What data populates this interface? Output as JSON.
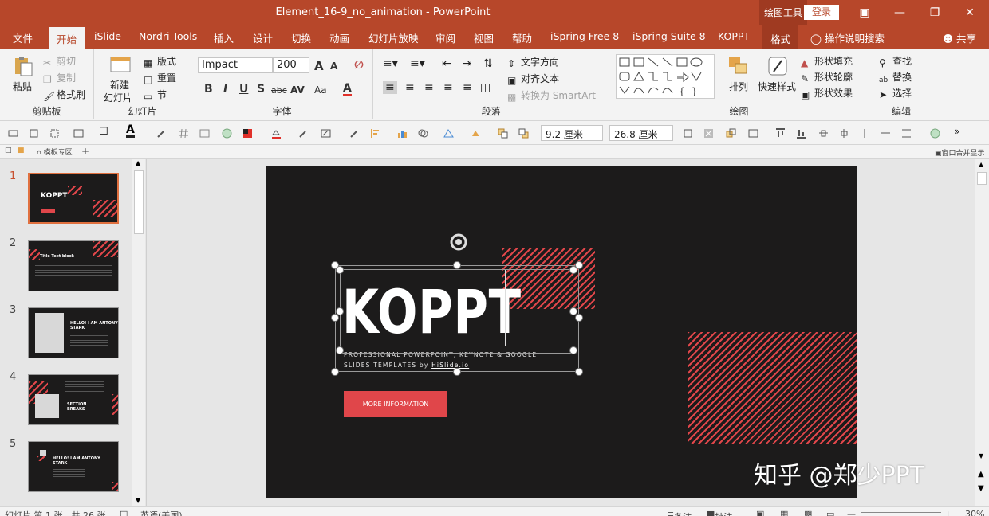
{
  "window": {
    "title": "Element_16-9_no_animation  -  PowerPoint",
    "context_tool": "绘图工具",
    "login": "登录"
  },
  "tabs": [
    "文件",
    "开始",
    "iSlide",
    "Nordri Tools",
    "插入",
    "设计",
    "切换",
    "动画",
    "幻灯片放映",
    "审阅",
    "视图",
    "帮助",
    "iSpring Free 8",
    "iSpring Suite 8",
    "KOPPT",
    "格式"
  ],
  "tab_search": "操作说明搜索",
  "tab_share": "共享",
  "ribbon": {
    "clipboard": {
      "paste": "粘贴",
      "cut": "剪切",
      "copy": "复制",
      "painter": "格式刷",
      "label": "剪贴板"
    },
    "slides": {
      "new_slide": "新建",
      "new_slide2": "幻灯片",
      "layout": "版式",
      "reset": "重置",
      "section": "节",
      "label": "幻灯片"
    },
    "font": {
      "family": "Impact",
      "size": "200",
      "label": "字体",
      "grow": "A",
      "shrink": "A",
      "bold": "B",
      "italic": "I",
      "underline": "U",
      "shadow": "S",
      "strike": "abc",
      "spacing": "AV",
      "case": "Aa",
      "color": "A"
    },
    "paragraph": {
      "text_direction": "文字方向",
      "align_text": "对齐文本",
      "smartart": "转换为 SmartArt",
      "label": "段落"
    },
    "drawing": {
      "arrange": "排列",
      "quick_styles": "快速样式",
      "fill": "形状填充",
      "outline": "形状轮廓",
      "effects": "形状效果",
      "label": "绘图"
    },
    "editing": {
      "find": "查找",
      "replace": "替换",
      "select": "选择",
      "label": "编辑"
    }
  },
  "quickbar": {
    "height": "9.2 厘米",
    "width": "26.8 厘米"
  },
  "docbar": {
    "template_area": "模板专区",
    "window_merge": "窗口合并显示"
  },
  "thumbnails": [
    {
      "num": "1",
      "label": "KOPPT"
    },
    {
      "num": "2",
      "label": "Title Text block"
    },
    {
      "num": "3",
      "label": "HELLO! I AM ANTONY STARK"
    },
    {
      "num": "4",
      "label": "SECTION BREAKS"
    },
    {
      "num": "5",
      "label": "HELLO! I AM ANTONY STARK"
    }
  ],
  "slide": {
    "title": "KOPPT",
    "subtitle_line1": "PROFESSIONAL POWERPOINT, KEYNOTE & GOOGLE",
    "subtitle_line2": "SLIDES TEMPLATES by ",
    "subtitle_link": "HiSlide.io",
    "button": "MORE INFORMATION"
  },
  "watermark": "知乎 @郑少PPT",
  "statusbar": {
    "slide_info": "幻灯片 第 1 张，共 26 张",
    "language": "英语(美国)",
    "notes": "备注",
    "comments": "批注",
    "zoom": "30%"
  },
  "colors": {
    "accent": "#b7472a",
    "slide_bg": "#1c1b1b",
    "slide_red": "#e0464a"
  }
}
